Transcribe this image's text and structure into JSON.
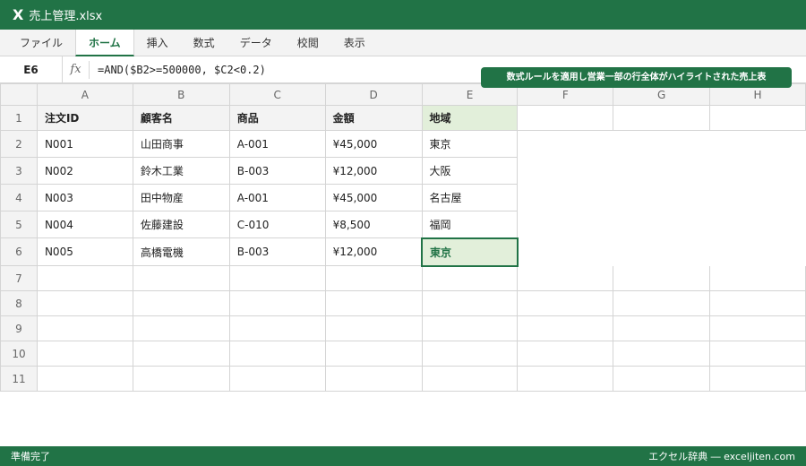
{
  "titlebar": {
    "app_icon": "X",
    "filename": "売上管理.xlsx"
  },
  "ribbon": {
    "tabs": [
      "ファイル",
      "ホーム",
      "挿入",
      "数式",
      "データ",
      "校閲",
      "表示"
    ],
    "active": "ホーム"
  },
  "formula_bar": {
    "cell_ref": "E6",
    "fx": "fx",
    "formula": "=AND($B2>=500000, $C2<0.2)"
  },
  "callout": "数式ルールを適用し営業一部の行全体がハイライトされた売上表",
  "columns": [
    "A",
    "B",
    "C",
    "D",
    "E",
    "F",
    "G",
    "H"
  ],
  "row_numbers": [
    "1",
    "2",
    "3",
    "4",
    "5",
    "6",
    "7",
    "8",
    "9",
    "10",
    "11"
  ],
  "table": {
    "headers": [
      "注文ID",
      "顧客名",
      "商品",
      "金額",
      "地域"
    ],
    "rows": [
      [
        "N001",
        "山田商事",
        "A-001",
        "¥45,000",
        "東京"
      ],
      [
        "N002",
        "鈴木工業",
        "B-003",
        "¥12,000",
        "大阪"
      ],
      [
        "N003",
        "田中物産",
        "A-001",
        "¥45,000",
        "名古屋"
      ],
      [
        "N004",
        "佐藤建設",
        "C-010",
        "¥8,500",
        "福岡"
      ],
      [
        "N005",
        "高橋電機",
        "B-003",
        "¥12,000",
        "東京"
      ]
    ]
  },
  "selected_cell": "E6",
  "colors": {
    "accent": "#217346",
    "highlight": "#e2efda"
  },
  "status": {
    "left": "準備完了",
    "right": "エクセル辞典 ― exceljiten.com"
  }
}
